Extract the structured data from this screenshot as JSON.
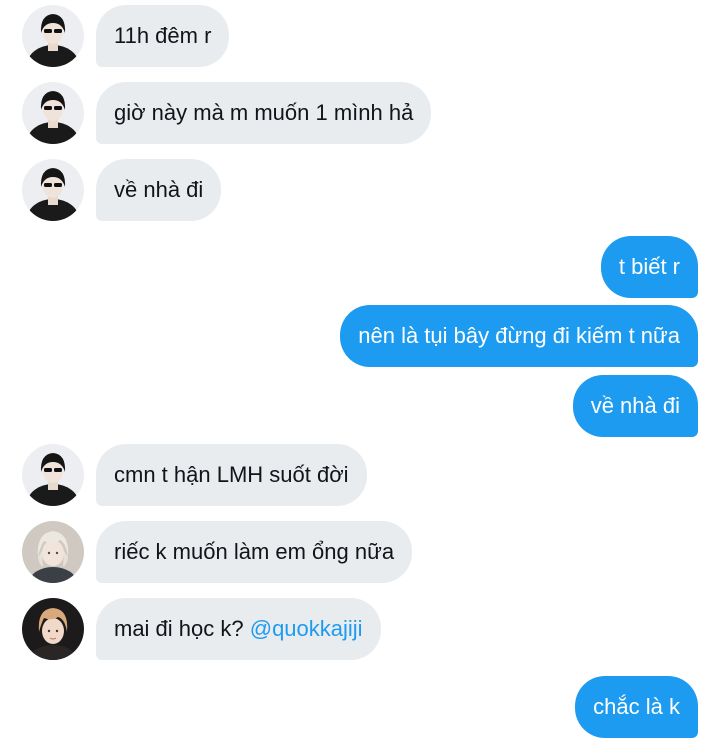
{
  "messages": [
    {
      "side": "in",
      "avatar": "avatar-dark-sunglasses",
      "text": "11h đêm r"
    },
    {
      "side": "in",
      "avatar": "avatar-dark-sunglasses",
      "text": "giờ này mà m muốn 1 mình hả"
    },
    {
      "side": "in",
      "avatar": "avatar-dark-sunglasses",
      "text": "về nhà đi"
    },
    {
      "side": "out",
      "text": "t biết r"
    },
    {
      "side": "out",
      "text": "nên là tụi bây đừng đi kiếm t nữa"
    },
    {
      "side": "out",
      "text": "về nhà đi"
    },
    {
      "side": "in",
      "avatar": "avatar-dark-sunglasses",
      "text": "cmn t hận LMH suốt đời"
    },
    {
      "side": "in",
      "avatar": "avatar-blonde-hair",
      "text": "riếc k muốn làm em ổng nữa"
    },
    {
      "side": "in",
      "avatar": "avatar-light-brown-hair",
      "text": "mai đi học k? ",
      "mention": "@quokkajiji"
    },
    {
      "side": "out",
      "text": "chắc là k"
    }
  ],
  "colors": {
    "incoming_bubble": "#e9ecef",
    "outgoing_bubble": "#1d9bf0",
    "mention": "#1d9bf0"
  }
}
